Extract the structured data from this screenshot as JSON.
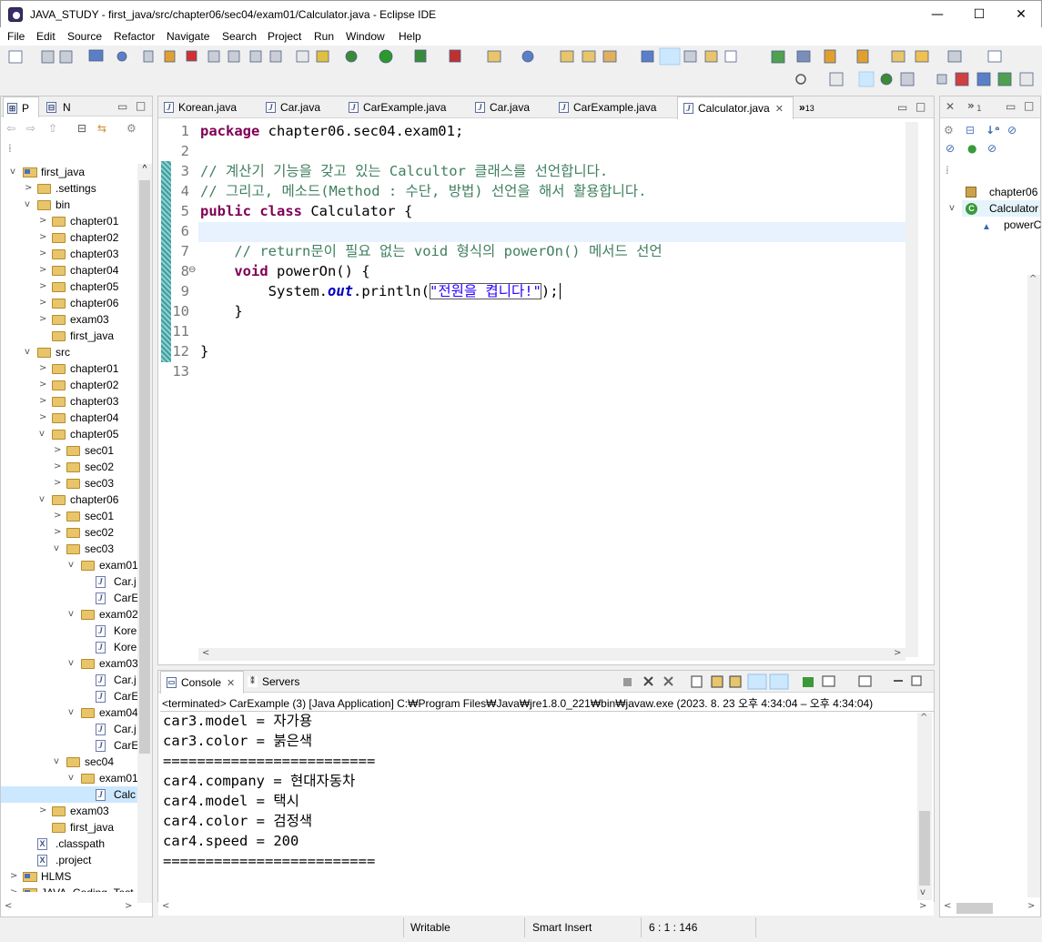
{
  "window": {
    "title": "JAVA_STUDY - first_java/src/chapter06/sec04/exam01/Calculator.java - Eclipse IDE",
    "minimize": "—",
    "maximize": "☐",
    "close": "✕"
  },
  "menu": [
    "File",
    "Edit",
    "Source",
    "Refactor",
    "Navigate",
    "Search",
    "Project",
    "Run",
    "Window",
    "Help"
  ],
  "explorer": {
    "tabs": [
      "P",
      "N"
    ],
    "rows": [
      {
        "label": "first_java",
        "type": "project",
        "depth": 0,
        "arrow": "v"
      },
      {
        "label": ".settings",
        "type": "folder",
        "depth": 1,
        "arrow": ">"
      },
      {
        "label": "bin",
        "type": "folder",
        "depth": 1,
        "arrow": "v"
      },
      {
        "label": "chapter01",
        "type": "folder",
        "depth": 2,
        "arrow": ">"
      },
      {
        "label": "chapter02",
        "type": "folder",
        "depth": 2,
        "arrow": ">"
      },
      {
        "label": "chapter03",
        "type": "folder",
        "depth": 2,
        "arrow": ">"
      },
      {
        "label": "chapter04",
        "type": "folder",
        "depth": 2,
        "arrow": ">"
      },
      {
        "label": "chapter05",
        "type": "folder",
        "depth": 2,
        "arrow": ">"
      },
      {
        "label": "chapter06",
        "type": "folder",
        "depth": 2,
        "arrow": ">"
      },
      {
        "label": "exam03",
        "type": "folder",
        "depth": 2,
        "arrow": ">"
      },
      {
        "label": "first_java",
        "type": "folder",
        "depth": 2,
        "arrow": ""
      },
      {
        "label": "src",
        "type": "folder",
        "depth": 1,
        "arrow": "v"
      },
      {
        "label": "chapter01",
        "type": "folder",
        "depth": 2,
        "arrow": ">"
      },
      {
        "label": "chapter02",
        "type": "folder",
        "depth": 2,
        "arrow": ">"
      },
      {
        "label": "chapter03",
        "type": "folder",
        "depth": 2,
        "arrow": ">"
      },
      {
        "label": "chapter04",
        "type": "folder",
        "depth": 2,
        "arrow": ">"
      },
      {
        "label": "chapter05",
        "type": "folder",
        "depth": 2,
        "arrow": "v"
      },
      {
        "label": "sec01",
        "type": "folder",
        "depth": 3,
        "arrow": ">"
      },
      {
        "label": "sec02",
        "type": "folder",
        "depth": 3,
        "arrow": ">"
      },
      {
        "label": "sec03",
        "type": "folder",
        "depth": 3,
        "arrow": ">"
      },
      {
        "label": "chapter06",
        "type": "folder",
        "depth": 2,
        "arrow": "v"
      },
      {
        "label": "sec01",
        "type": "folder",
        "depth": 3,
        "arrow": ">"
      },
      {
        "label": "sec02",
        "type": "folder",
        "depth": 3,
        "arrow": ">"
      },
      {
        "label": "sec03",
        "type": "folder",
        "depth": 3,
        "arrow": "v"
      },
      {
        "label": "exam01",
        "type": "folder",
        "depth": 4,
        "arrow": "v"
      },
      {
        "label": "Car.j",
        "type": "java",
        "depth": 5,
        "arrow": ""
      },
      {
        "label": "CarE",
        "type": "java",
        "depth": 5,
        "arrow": ""
      },
      {
        "label": "exam02",
        "type": "folder",
        "depth": 4,
        "arrow": "v"
      },
      {
        "label": "Kore",
        "type": "java",
        "depth": 5,
        "arrow": ""
      },
      {
        "label": "Kore",
        "type": "java",
        "depth": 5,
        "arrow": ""
      },
      {
        "label": "exam03",
        "type": "folder",
        "depth": 4,
        "arrow": "v"
      },
      {
        "label": "Car.j",
        "type": "java",
        "depth": 5,
        "arrow": ""
      },
      {
        "label": "CarE",
        "type": "java",
        "depth": 5,
        "arrow": ""
      },
      {
        "label": "exam04",
        "type": "folder",
        "depth": 4,
        "arrow": "v"
      },
      {
        "label": "Car.j",
        "type": "java",
        "depth": 5,
        "arrow": ""
      },
      {
        "label": "CarE",
        "type": "java",
        "depth": 5,
        "arrow": ""
      },
      {
        "label": "sec04",
        "type": "folder",
        "depth": 3,
        "arrow": "v"
      },
      {
        "label": "exam01",
        "type": "folder",
        "depth": 4,
        "arrow": "v"
      },
      {
        "label": "Calc",
        "type": "java",
        "depth": 5,
        "arrow": "",
        "selected": true
      },
      {
        "label": "exam03",
        "type": "folder",
        "depth": 2,
        "arrow": ">"
      },
      {
        "label": "first_java",
        "type": "folder",
        "depth": 2,
        "arrow": ""
      },
      {
        "label": ".classpath",
        "type": "xml",
        "depth": 1,
        "arrow": ""
      },
      {
        "label": ".project",
        "type": "xml",
        "depth": 1,
        "arrow": ""
      },
      {
        "label": "HLMS",
        "type": "project",
        "depth": 0,
        "arrow": ">"
      },
      {
        "label": "JAVA_Coding_Test",
        "type": "project",
        "depth": 0,
        "arrow": ">"
      }
    ]
  },
  "editor": {
    "tabs": [
      {
        "label": "Korean.java"
      },
      {
        "label": "Car.java"
      },
      {
        "label": "CarExample.java"
      },
      {
        "label": "Car.java"
      },
      {
        "label": "CarExample.java"
      },
      {
        "label": "Calculator.java",
        "active": true
      }
    ],
    "overflow": "»",
    "overflow_count": "13",
    "lines": [
      "1",
      "2",
      "3",
      "4",
      "5",
      "6",
      "7",
      "8",
      "9",
      "10",
      "11",
      "12",
      "13"
    ],
    "code": {
      "l1_kw": "package",
      "l1_rest": " chapter06.sec04.exam01;",
      "l3": "// 계산기 기능을 갖고 있는 Calcultor 클래스를 선언합니다.",
      "l4": "// 그리고, 메소드(Method : 수단, 방법) 선언을 해서 활용합니다.",
      "l5_kw": "public class",
      "l5_rest": " Calculator {",
      "l7": "    // return문이 필요 없는 void 형식의 powerOn() 메서드 선언",
      "l8_kw": "    void",
      "l8_rest": " powerOn() {",
      "l9_a": "        System.",
      "l9_field": "out",
      "l9_b": ".println(",
      "l9_str": "\"전원을 켭니다!\"",
      "l9_c": ");",
      "l10": "    }",
      "l12": "}"
    }
  },
  "outline": {
    "tabs": [
      "✕",
      "»",
      "1"
    ],
    "items": [
      {
        "label": "chapter06"
      },
      {
        "label": "Calculator"
      },
      {
        "label": "powerC"
      }
    ]
  },
  "console": {
    "tabs": [
      {
        "label": "Console",
        "active": true
      },
      {
        "label": "Servers"
      }
    ],
    "status": "<terminated> CarExample (3) [Java Application] C:₩Program Files₩Java₩jre1.8.0_221₩bin₩javaw.exe  (2023. 8. 23 오후 4:34:04 – 오후 4:34:04)",
    "lines": [
      "car3.model = 자가용",
      "car3.color = 붉은색",
      "=========================",
      "car4.company = 현대자동차",
      "car4.model = 택시",
      "car4.color = 검정색",
      "car4.speed = 200",
      "========================="
    ]
  },
  "statusbar": {
    "writable": "Writable",
    "insert": "Smart Insert",
    "position": "6 : 1 : 146"
  },
  "colors": {
    "keyword": "#7f0055",
    "comment": "#3f7f5f",
    "string": "#2a00ff",
    "field": "#0000c0",
    "current_line": "#e8f2fe",
    "selection": "#cce8ff"
  }
}
